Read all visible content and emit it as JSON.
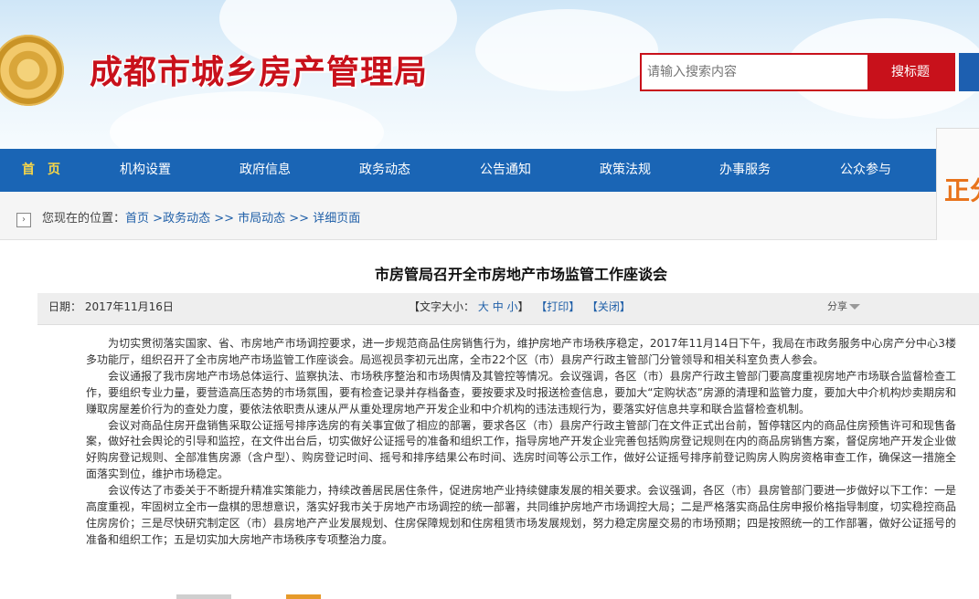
{
  "header": {
    "site_title": "成都市城乡房产管理局",
    "search_placeholder": "请输入搜索内容",
    "search_button": "搜标题"
  },
  "nav": {
    "items": [
      "首　页",
      "机构设置",
      "政府信息",
      "政务动态",
      "公告通知",
      "政策法规",
      "办事服务",
      "公众参与"
    ]
  },
  "side_banner": {
    "text": "正分"
  },
  "breadcrumb": {
    "prefix": "您现在的位置：",
    "crumbs": [
      "首页",
      ">政务动态",
      ">> 市局动态",
      ">> 详细页面"
    ]
  },
  "article": {
    "title": "市房管局召开全市房地产市场监管工作座谈会",
    "date": "日期：  2017年11月16日",
    "font_size_label": "【文字大小：",
    "size_large": "大",
    "size_medium": "中",
    "size_small": "小",
    "font_size_close": "】",
    "print": "【打印】",
    "close": "【关闭】",
    "share": "分享",
    "paragraphs": [
      "为切实贯彻落实国家、省、市房地产市场调控要求，进一步规范商品住房销售行为，维护房地产市场秩序稳定，2017年11月14日下午，我局在市政务服务中心房产分中心3楼多功能厅，组织召开了全市房地产市场监管工作座谈会。局巡视员李初元出席，全市22个区（市）县房产行政主管部门分管领导和相关科室负责人参会。",
      "会议通报了我市房地产市场总体运行、监察执法、市场秩序整治和市场舆情及其管控等情况。会议强调，各区（市）县房产行政主管部门要高度重视房地产市场联合监督检查工作，要组织专业力量，要营造高压态势的市场氛围，要有检查记录并存档备查，要按要求及时报送检查信息，要加大“定购状态”房源的清理和监管力度，要加大中介机构炒卖期房和赚取房屋差价行为的查处力度，要依法依职责从速从严从重处理房地产开发企业和中介机构的违法违规行为，要落实好信息共享和联合监督检查机制。",
      "会议对商品住房开盘销售采取公证摇号排序选房的有关事宜做了相应的部署，要求各区（市）县房产行政主管部门在文件正式出台前，暂停辖区内的商品住房预售许可和现售备案，做好社会舆论的引导和监控，在文件出台后，切实做好公证摇号的准备和组织工作，指导房地产开发企业完善包括购房登记规则在内的商品房销售方案，督促房地产开发企业做好购房登记规则、全部准售房源（含户型）、购房登记时间、摇号和排序结果公布时间、选房时间等公示工作，做好公证摇号排序前登记购房人购房资格审查工作，确保这一措施全面落实到位，维护市场稳定。",
      "会议传达了市委关于不断提升精准实策能力，持续改善居民居住条件，促进房地产业持续健康发展的相关要求。会议强调，各区（市）县房管部门要进一步做好以下工作：一是高度重视，牢固树立全市一盘棋的思想意识，落实好我市关于房地产市场调控的统一部署，共同维护房地产市场调控大局；二是严格落实商品住房申报价格指导制度，切实稳控商品住房房价；三是尽快研究制定区（市）县房地产产业发展规划、住房保障规划和住房租赁市场发展规划，努力稳定房屋交易的市场预期；四是按照统一的工作部署，做好公证摇号的准备和组织工作；五是切实加大房地产市场秩序专项整治力度。"
    ]
  }
}
